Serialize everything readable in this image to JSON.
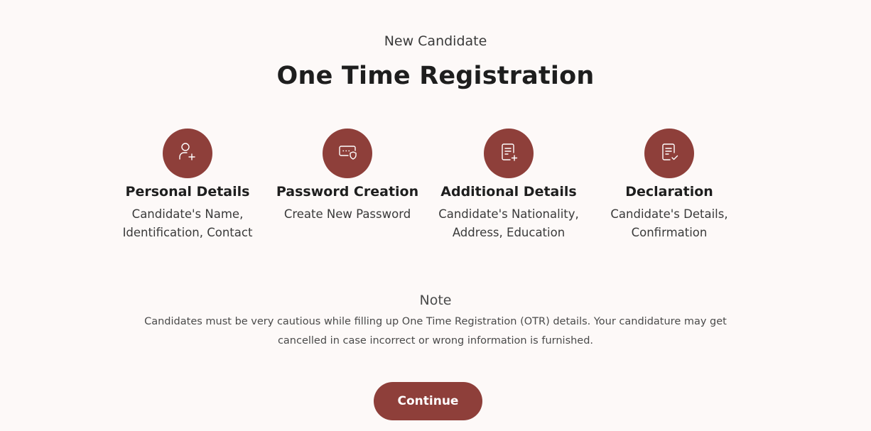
{
  "header": {
    "subtitle": "New Candidate",
    "title": "One Time Registration"
  },
  "steps": [
    {
      "icon": "user-plus-icon",
      "title": "Personal Details",
      "description": "Candidate's Name, Identification, Contact"
    },
    {
      "icon": "password-shield-icon",
      "title": "Password Creation",
      "description": "Create New Password"
    },
    {
      "icon": "document-plus-icon",
      "title": "Additional Details",
      "description": "Candidate's Nationality, Address, Education"
    },
    {
      "icon": "document-check-icon",
      "title": "Declaration",
      "description": "Candidate's Details, Confirmation"
    }
  ],
  "note": {
    "heading": "Note",
    "text": "Candidates must be very cautious while filling up One Time Registration (OTR) details. Your candidature may get cancelled in case incorrect or wrong information is furnished."
  },
  "actions": {
    "continue_label": "Continue"
  },
  "colors": {
    "accent": "#8e3f3a",
    "background": "#fdf9f8"
  }
}
